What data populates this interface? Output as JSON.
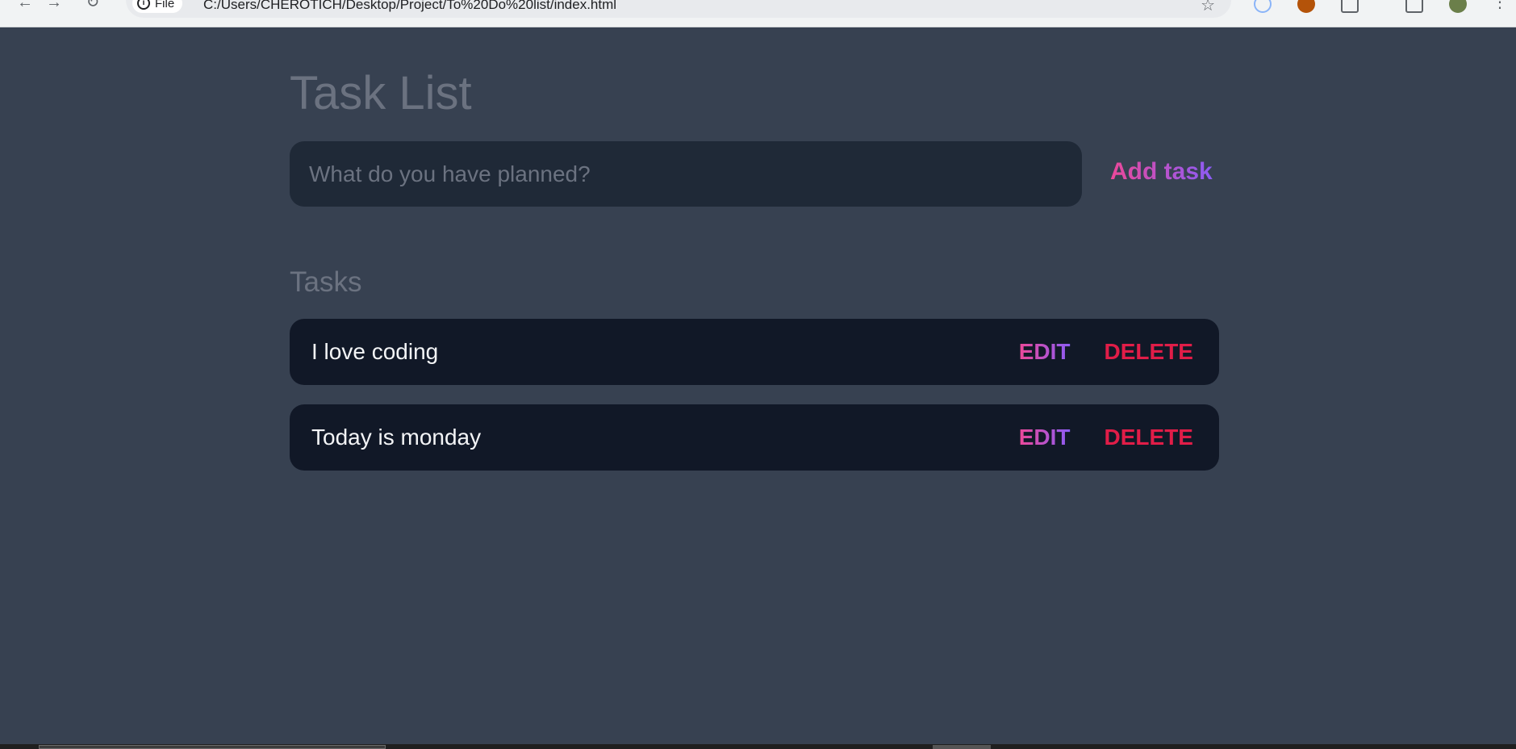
{
  "browser": {
    "site_chip_label": "File",
    "url": "C:/Users/CHEROTICH/Desktop/Project/To%20Do%20list/index.html"
  },
  "page": {
    "title": "Task List",
    "input_placeholder": "What do you have planned?",
    "input_value": "",
    "add_button_label": "Add task",
    "section_heading": "Tasks"
  },
  "tasks": [
    {
      "text": "I love coding",
      "edit_label": "EDIT",
      "delete_label": "DELETE"
    },
    {
      "text": "Today is monday",
      "edit_label": "EDIT",
      "delete_label": "DELETE"
    }
  ],
  "colors": {
    "page_background": "#374151",
    "input_background": "#1f2937",
    "task_background": "#111827",
    "muted_text": "#6b7280",
    "accent_gradient_start": "#ec4899",
    "accent_gradient_end": "#8b5cf6",
    "delete_color": "#e11d48"
  }
}
